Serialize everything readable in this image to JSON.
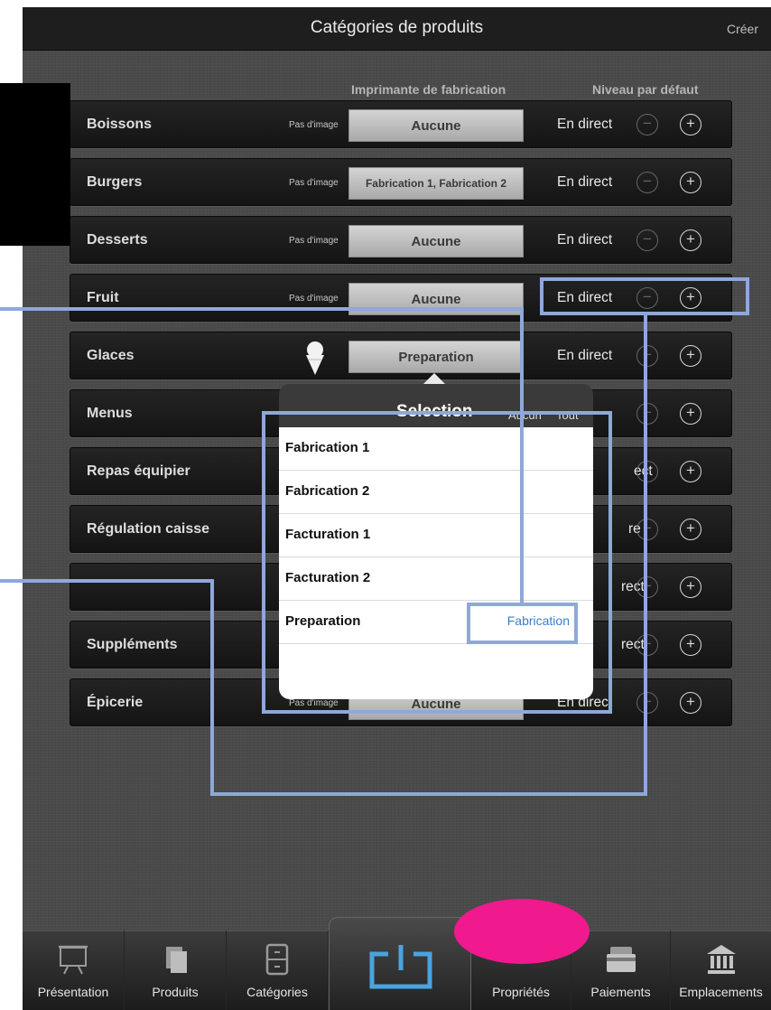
{
  "header": {
    "title": "Catégories de produits",
    "create_label": "Créer"
  },
  "columns": {
    "printer": "Imprimante de fabrication",
    "level": "Niveau par défaut"
  },
  "categories": [
    {
      "name": "Boissons",
      "image": "Pas d'image",
      "printer": "Aucune",
      "level": "En direct"
    },
    {
      "name": "Burgers",
      "image": "Pas d'image",
      "printer": "Fabrication 1, Fabrication 2",
      "level": "En direct"
    },
    {
      "name": "Desserts",
      "image": "Pas d'image",
      "printer": "Aucune",
      "level": "En direct"
    },
    {
      "name": "Fruit",
      "image": "Pas d'image",
      "printer": "Aucune",
      "level": "En direct"
    },
    {
      "name": "Glaces",
      "image": "",
      "printer": "Preparation",
      "level": "En direct"
    },
    {
      "name": "Menus",
      "image": "",
      "printer": "",
      "level": ""
    },
    {
      "name": "Repas équipier",
      "image": "",
      "printer": "",
      "level": "ect"
    },
    {
      "name": "Régulation caisse",
      "image": "",
      "printer": "",
      "level": "re"
    },
    {
      "name": "",
      "image": "",
      "printer": "",
      "level": "rect"
    },
    {
      "name": "Suppléments",
      "image": "",
      "printer": "",
      "level": "rect"
    },
    {
      "name": "Épicerie",
      "image": "Pas d'image",
      "printer": "Aucune",
      "level": "En direct"
    }
  ],
  "popover": {
    "title": "Selection",
    "none_label": "Aucun",
    "all_label": "Tout",
    "items": [
      {
        "label": "Fabrication 1",
        "tag": ""
      },
      {
        "label": "Fabrication 2",
        "tag": ""
      },
      {
        "label": "Facturation 1",
        "tag": ""
      },
      {
        "label": "Facturation 2",
        "tag": ""
      },
      {
        "label": "Preparation",
        "tag": "Fabrication"
      }
    ]
  },
  "tabs": [
    {
      "label": "Présentation",
      "icon": "presentation-easel-icon"
    },
    {
      "label": "Produits",
      "icon": "products-documents-icon"
    },
    {
      "label": "Catégories",
      "icon": "categories-cabinet-icon"
    },
    {
      "label": "",
      "icon": "power-export-icon"
    },
    {
      "label": "Propriétés",
      "icon": "properties-icon"
    },
    {
      "label": "Paiements",
      "icon": "payments-card-icon"
    },
    {
      "label": "Emplacements",
      "icon": "locations-bank-icon"
    }
  ],
  "colors": {
    "annotation": "#8ea8d9",
    "highlight_marker": "#f0198d",
    "link": "#3a7fc8"
  }
}
